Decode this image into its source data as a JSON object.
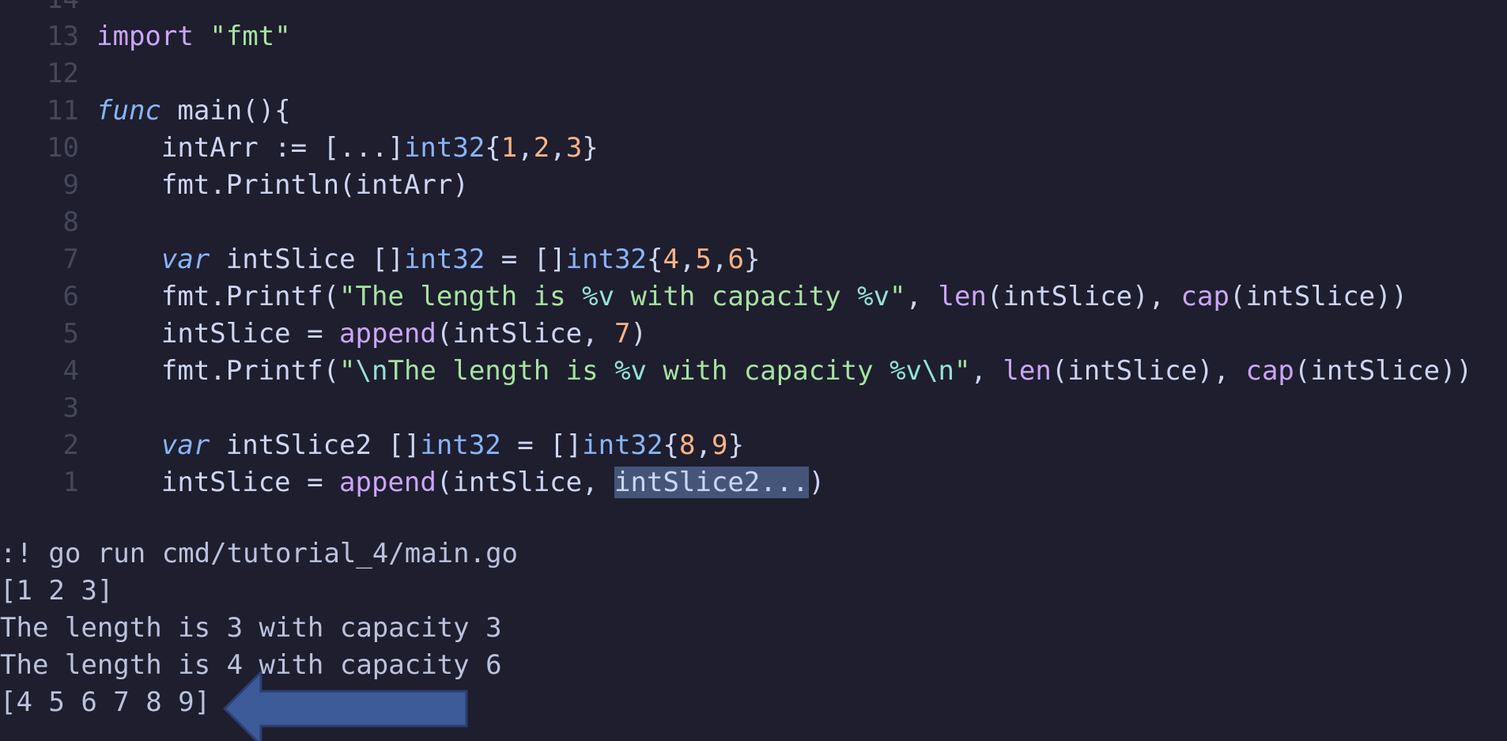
{
  "editor": {
    "lines": [
      {
        "num": "14",
        "tokens": []
      },
      {
        "num": "13",
        "tokens": [
          {
            "t": "import",
            "c": "kw"
          },
          {
            "t": " ",
            "c": "plain"
          },
          {
            "t": "\"fmt\"",
            "c": "str"
          }
        ]
      },
      {
        "num": "12",
        "tokens": []
      },
      {
        "num": "11",
        "tokens": [
          {
            "t": "func",
            "c": "kwi"
          },
          {
            "t": " main(){",
            "c": "plain"
          }
        ]
      },
      {
        "num": "10",
        "tokens": [
          {
            "t": "    intArr := [...]",
            "c": "plain"
          },
          {
            "t": "int32",
            "c": "type"
          },
          {
            "t": "{",
            "c": "plain"
          },
          {
            "t": "1",
            "c": "num"
          },
          {
            "t": ",",
            "c": "plain"
          },
          {
            "t": "2",
            "c": "num"
          },
          {
            "t": ",",
            "c": "plain"
          },
          {
            "t": "3",
            "c": "num"
          },
          {
            "t": "}",
            "c": "plain"
          }
        ]
      },
      {
        "num": "9",
        "tokens": [
          {
            "t": "    fmt.Println(intArr)",
            "c": "plain"
          }
        ]
      },
      {
        "num": "8",
        "tokens": []
      },
      {
        "num": "7",
        "tokens": [
          {
            "t": "    ",
            "c": "plain"
          },
          {
            "t": "var",
            "c": "kwi"
          },
          {
            "t": " intSlice []",
            "c": "plain"
          },
          {
            "t": "int32",
            "c": "type"
          },
          {
            "t": " = []",
            "c": "plain"
          },
          {
            "t": "int32",
            "c": "type"
          },
          {
            "t": "{",
            "c": "plain"
          },
          {
            "t": "4",
            "c": "num"
          },
          {
            "t": ",",
            "c": "plain"
          },
          {
            "t": "5",
            "c": "num"
          },
          {
            "t": ",",
            "c": "plain"
          },
          {
            "t": "6",
            "c": "num"
          },
          {
            "t": "}",
            "c": "plain"
          }
        ]
      },
      {
        "num": "6",
        "tokens": [
          {
            "t": "    fmt.Printf(",
            "c": "plain"
          },
          {
            "t": "\"The length is ",
            "c": "str"
          },
          {
            "t": "%v",
            "c": "fmtv"
          },
          {
            "t": " with capacity ",
            "c": "str"
          },
          {
            "t": "%v",
            "c": "fmtv"
          },
          {
            "t": "\"",
            "c": "str"
          },
          {
            "t": ", ",
            "c": "plain"
          },
          {
            "t": "len",
            "c": "builtin"
          },
          {
            "t": "(intSlice), ",
            "c": "plain"
          },
          {
            "t": "cap",
            "c": "builtin"
          },
          {
            "t": "(intSlice))",
            "c": "plain"
          }
        ]
      },
      {
        "num": "5",
        "tokens": [
          {
            "t": "    intSlice = ",
            "c": "plain"
          },
          {
            "t": "append",
            "c": "builtin"
          },
          {
            "t": "(intSlice, ",
            "c": "plain"
          },
          {
            "t": "7",
            "c": "num"
          },
          {
            "t": ")",
            "c": "plain"
          }
        ]
      },
      {
        "num": "4",
        "tokens": [
          {
            "t": "    fmt.Printf(",
            "c": "plain"
          },
          {
            "t": "\"",
            "c": "str"
          },
          {
            "t": "\\n",
            "c": "fmtv"
          },
          {
            "t": "The length is ",
            "c": "str"
          },
          {
            "t": "%v",
            "c": "fmtv"
          },
          {
            "t": " with capacity ",
            "c": "str"
          },
          {
            "t": "%v",
            "c": "fmtv"
          },
          {
            "t": "\\n",
            "c": "fmtv"
          },
          {
            "t": "\"",
            "c": "str"
          },
          {
            "t": ", ",
            "c": "plain"
          },
          {
            "t": "len",
            "c": "builtin"
          },
          {
            "t": "(intSlice), ",
            "c": "plain"
          },
          {
            "t": "cap",
            "c": "builtin"
          },
          {
            "t": "(intSlice))",
            "c": "plain"
          }
        ]
      },
      {
        "num": "3",
        "tokens": []
      },
      {
        "num": "2",
        "tokens": [
          {
            "t": "    ",
            "c": "plain"
          },
          {
            "t": "var",
            "c": "kwi"
          },
          {
            "t": " intSlice2 []",
            "c": "plain"
          },
          {
            "t": "int32",
            "c": "type"
          },
          {
            "t": " = []",
            "c": "plain"
          },
          {
            "t": "int32",
            "c": "type"
          },
          {
            "t": "{",
            "c": "plain"
          },
          {
            "t": "8",
            "c": "num"
          },
          {
            "t": ",",
            "c": "plain"
          },
          {
            "t": "9",
            "c": "num"
          },
          {
            "t": "}",
            "c": "plain"
          }
        ]
      },
      {
        "num": "1",
        "tokens": [
          {
            "t": "    intSlice = ",
            "c": "plain"
          },
          {
            "t": "append",
            "c": "builtin"
          },
          {
            "t": "(intSlice, ",
            "c": "plain"
          },
          {
            "t": "intSlice2...",
            "c": "sel"
          },
          {
            "t": ")",
            "c": "plain"
          }
        ]
      }
    ]
  },
  "terminal": {
    "command": ":! go run cmd/tutorial_4/main.go",
    "output": [
      "[1 2 3]",
      "The length is 3 with capacity 3",
      "The length is 4 with capacity 6",
      "[4 5 6 7 8 9]"
    ]
  },
  "annotation": {
    "arrow_color": "#3d5a99",
    "arrow_border": "#2a3f70",
    "icon": "left-arrow-icon"
  }
}
